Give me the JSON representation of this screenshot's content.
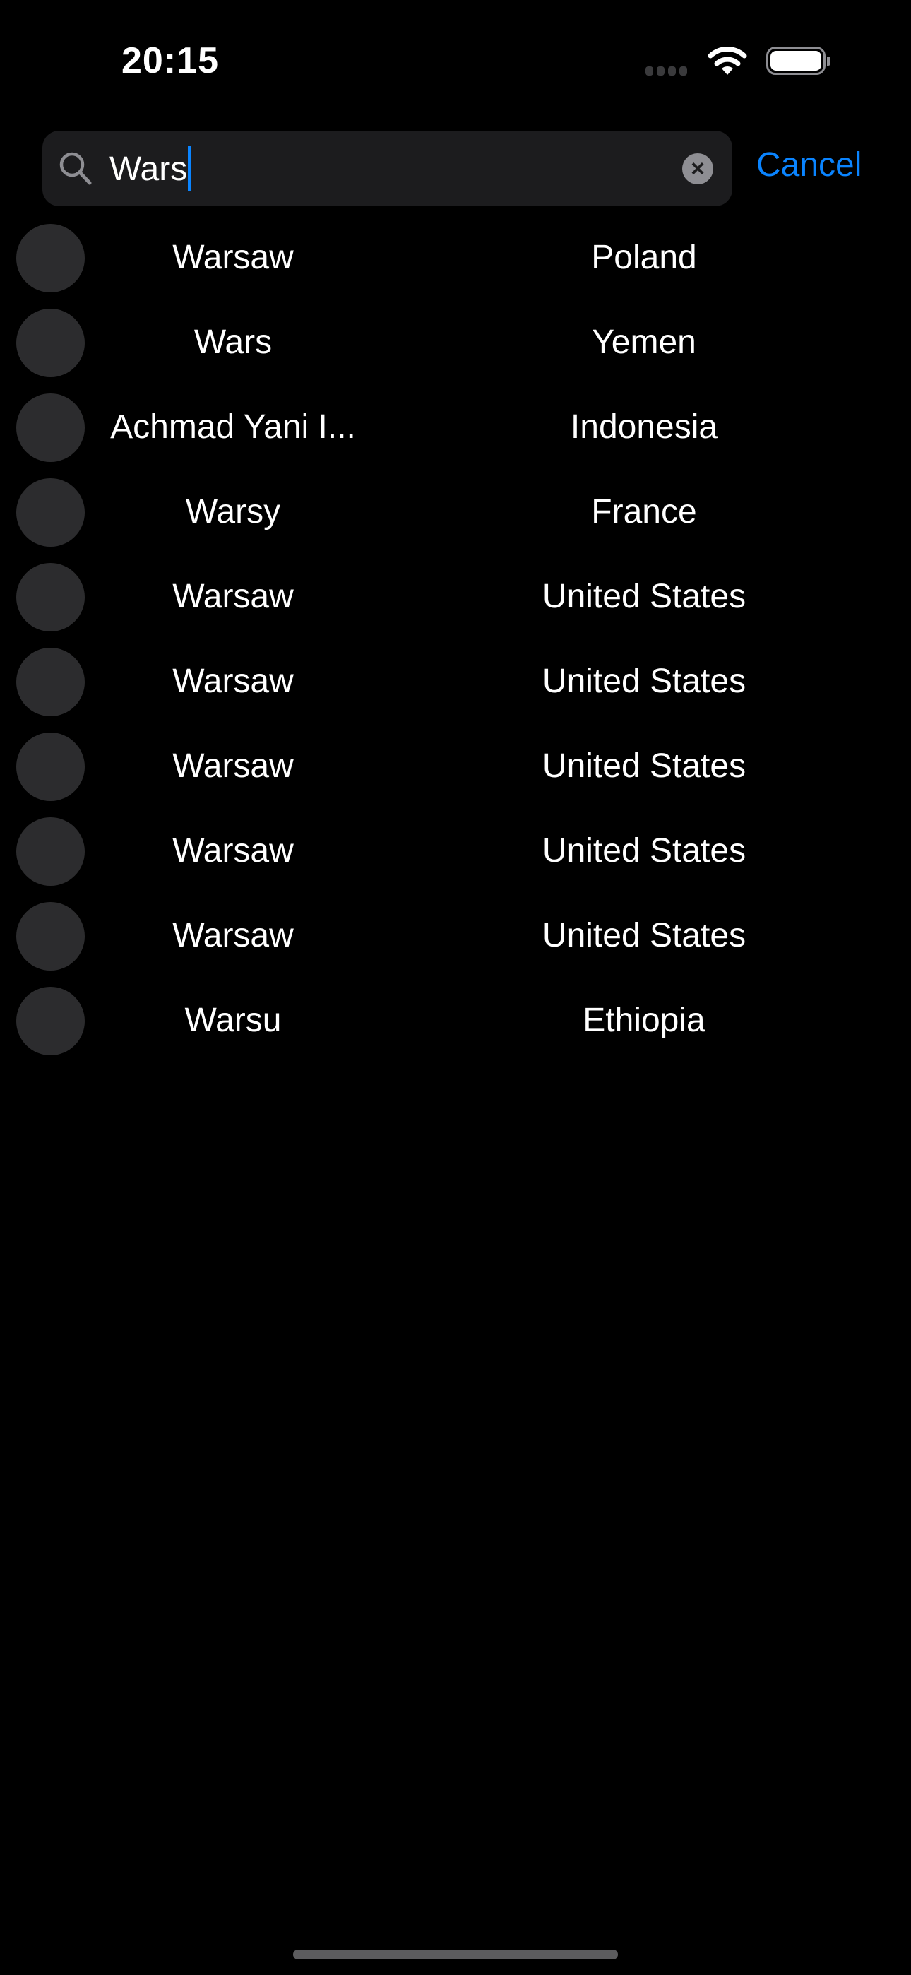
{
  "status_bar": {
    "time": "20:15"
  },
  "search": {
    "query": "Wars",
    "cancel_label": "Cancel"
  },
  "results": [
    {
      "city": "Warsaw",
      "country": "Poland"
    },
    {
      "city": "Wars",
      "country": "Yemen"
    },
    {
      "city": "Achmad Yani I...",
      "country": "Indonesia"
    },
    {
      "city": "Warsy",
      "country": "France"
    },
    {
      "city": "Warsaw",
      "country": "United States"
    },
    {
      "city": "Warsaw",
      "country": "United States"
    },
    {
      "city": "Warsaw",
      "country": "United States"
    },
    {
      "city": "Warsaw",
      "country": "United States"
    },
    {
      "city": "Warsaw",
      "country": "United States"
    },
    {
      "city": "Warsu",
      "country": "Ethiopia"
    }
  ]
}
